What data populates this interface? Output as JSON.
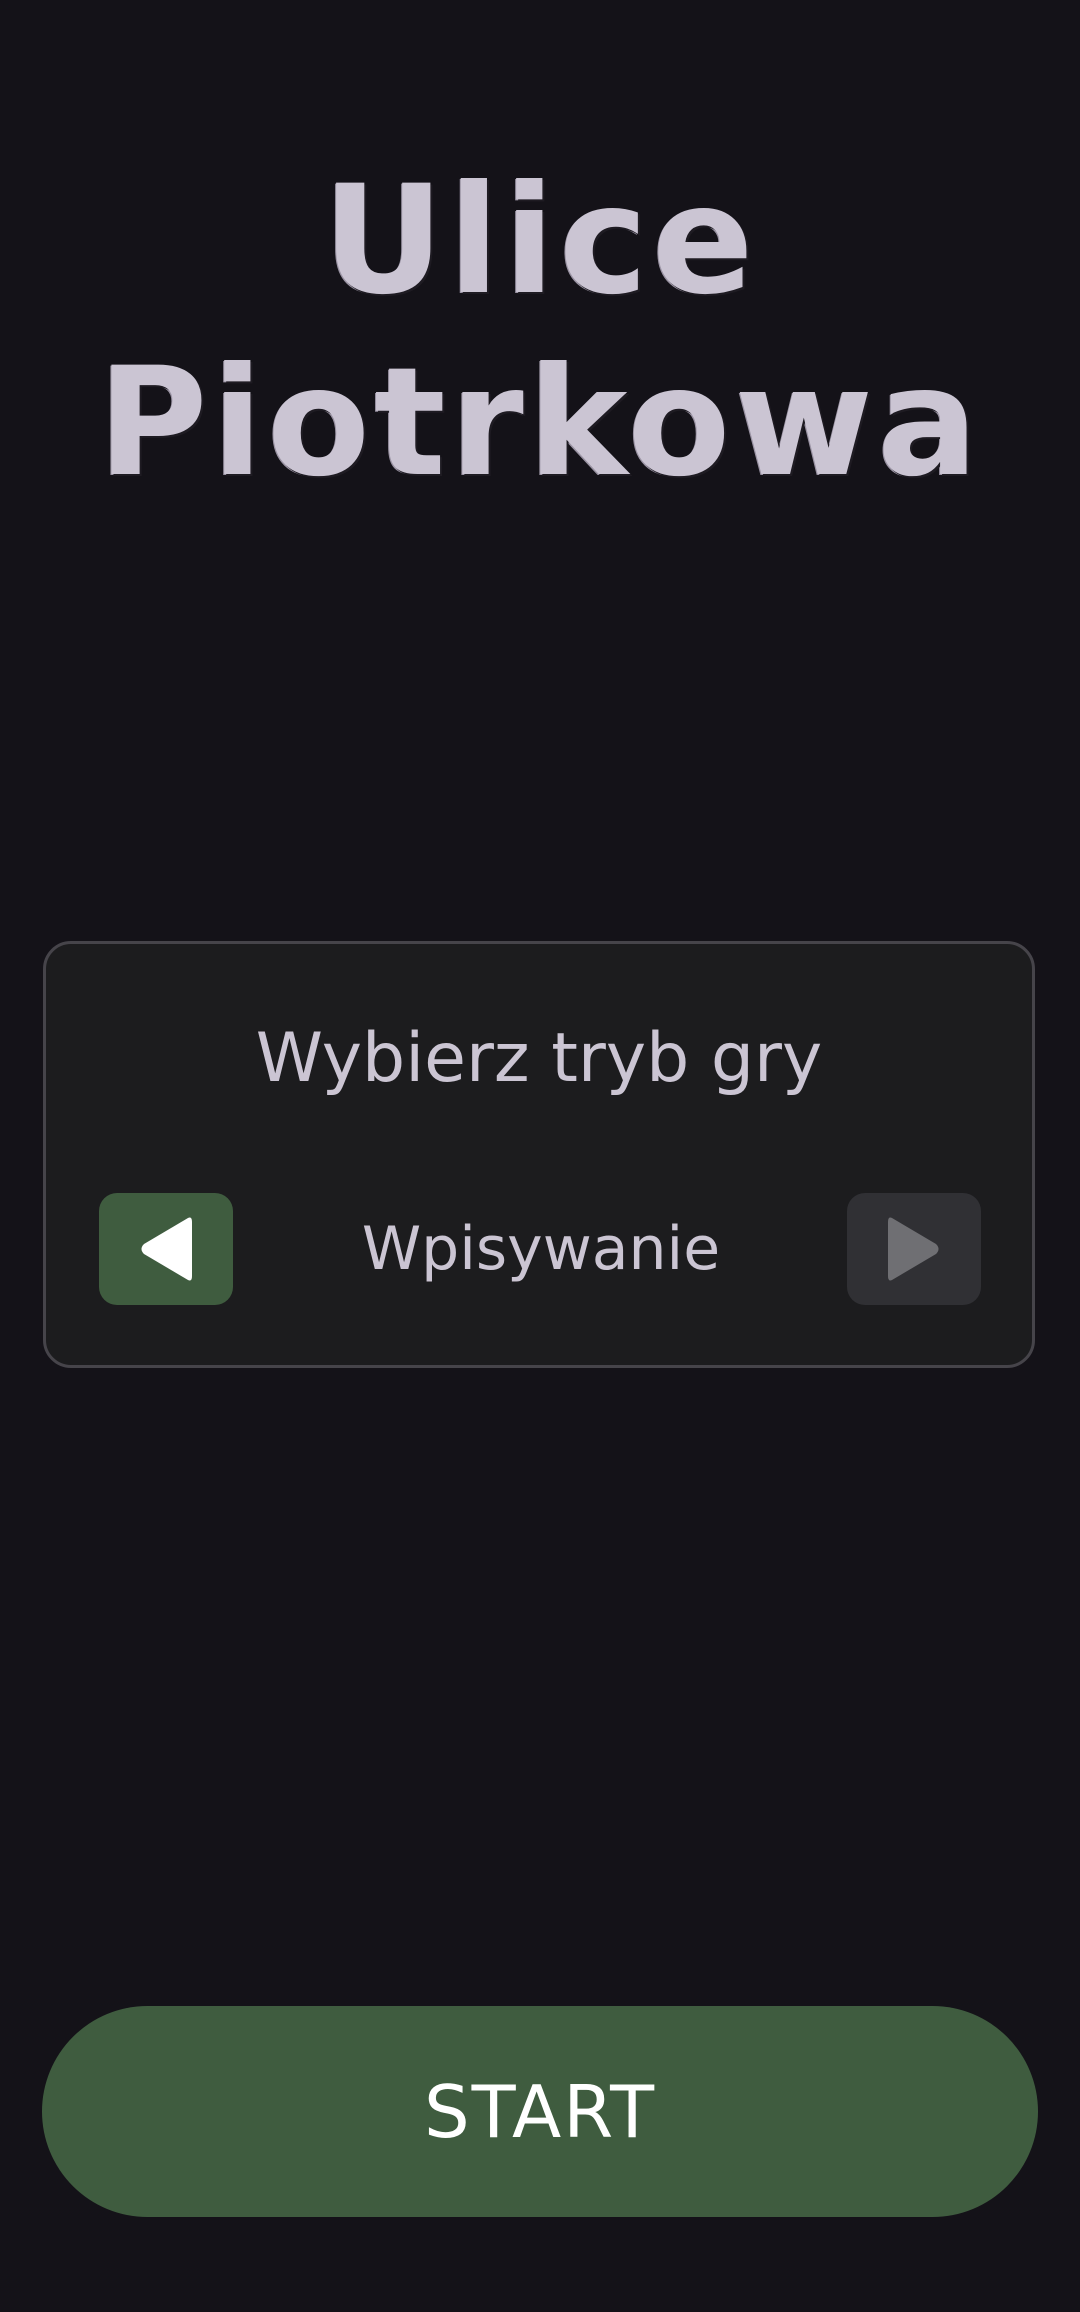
{
  "app": {
    "title_line_1": "Ulice",
    "title_line_2": "Piotrkowa"
  },
  "mode_selector": {
    "heading": "Wybierz tryb gry",
    "current_mode": "Wpisywanie",
    "prev_icon": "triangle-left-icon",
    "next_icon": "triangle-right-icon"
  },
  "start_button": {
    "label": "START"
  },
  "colors": {
    "background": "#141218",
    "accent_green": "#3f5c3f",
    "card_background": "#1c1c1e",
    "text_light": "#cbc5d3"
  }
}
